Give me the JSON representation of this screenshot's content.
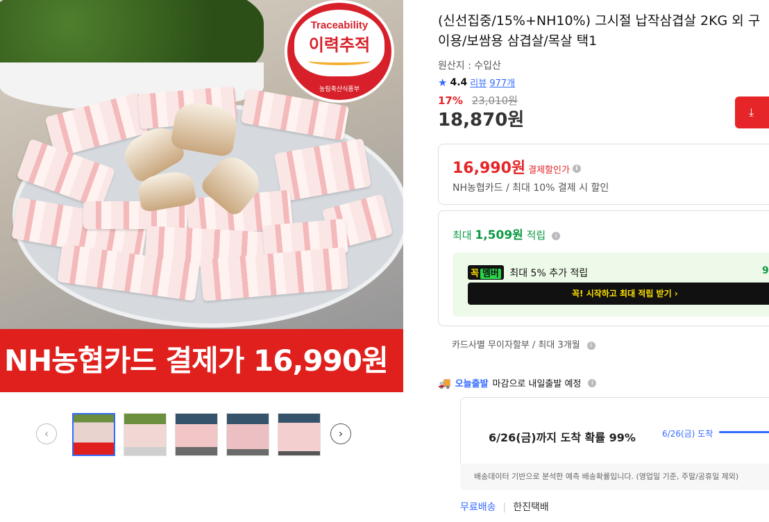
{
  "hero": {
    "badge": {
      "en": "Traceability",
      "ko": "이력추적",
      "issuer": "농림축산식품부"
    },
    "banner": "NH농협카드 결제가 16,990원",
    "thumb_caption": "NH농협카드 결제가 16,990원"
  },
  "thumbnails": {
    "prev_icon": "chevron-left-icon",
    "next_icon": "chevron-right-icon",
    "count": 5,
    "selected_index": 0
  },
  "product": {
    "title": "(신선집중/15%+NH10%) 그시절 납작삼겹살 2KG 외 구이용/보쌈용 삼겹살/목살 택1",
    "origin": "원산지 : 수입산",
    "rating": "4.4",
    "reviews_label": "리뷰",
    "reviews_count": "977개",
    "discount_pct": "17%",
    "original_price": "23,010원",
    "price": "18,870원",
    "download_icon": "download-icon"
  },
  "card_offer": {
    "price": "16,990원",
    "label": "결제할인가",
    "desc": "NH농협카드 / 최대 10% 결제 시 할인"
  },
  "points": {
    "prefix": "최대",
    "amount": "1,509원",
    "suffix": "적립",
    "member_tag": "꼭",
    "member_tag2": "멤버",
    "member_text": "최대 5% 추가 적립",
    "member_partial": "9",
    "cta": "꼭! 시작하고 최대 적립 받기  ›"
  },
  "installment": "카드사별 무이자할부 / 최대 3개월",
  "shipping": {
    "brand": "오늘출발",
    "text": "마감으로 내일출발 예정",
    "probability": "6/26(금)까지 도착 확률 99%",
    "date_label": "6/26(금) 도착",
    "footer": "배송데이터 기반으로 분석한 예측 배송확률입니다. (영업일 기준, 주말/공휴일 제외)",
    "free": "무료배송",
    "courier": "한진택배"
  },
  "colors": {
    "red": "#e52528",
    "blue": "#346aff",
    "green": "#0d9a43"
  }
}
